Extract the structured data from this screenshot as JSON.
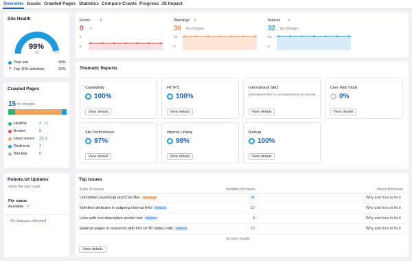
{
  "tabs": [
    "Overview",
    "Issues",
    "Crawled Pages",
    "Statistics",
    "Compare Crawls",
    "Progress",
    "JS Impact"
  ],
  "site_health": {
    "title": "Site Health",
    "score": "99%",
    "delta": "+3",
    "your_site_label": "Your site",
    "your_site_value": "99%",
    "top_label": "Top-10% websites",
    "top_value": "92%"
  },
  "crawled_pages": {
    "title": "Crawled Pages",
    "count": "15",
    "count_note": "no changes",
    "rows": [
      {
        "label": "Healthy",
        "value": "2",
        "delta": "+1",
        "color": "#2bb673"
      },
      {
        "label": "Broken",
        "value": "0",
        "delta": "",
        "color": "#e5484d"
      },
      {
        "label": "Have issues",
        "value": "12",
        "delta": "-1",
        "color": "#f0a35e"
      },
      {
        "label": "Redirects",
        "value": "1",
        "delta": "",
        "color": "#1e9bde"
      },
      {
        "label": "Blocked",
        "value": "0",
        "delta": "",
        "color": "#b0b4bd"
      }
    ]
  },
  "metrics": [
    {
      "label": "Errors",
      "value": "0",
      "delta": "-1",
      "color": "#e5484d",
      "fill": "#fbe0e2",
      "axis": [
        "1",
        "0"
      ]
    },
    {
      "label": "Warnings",
      "value": "36",
      "delta": "no changes",
      "color": "#f08a4b",
      "fill": "#fde6d6",
      "axis": [
        "36",
        "0"
      ]
    },
    {
      "label": "Notices",
      "value": "32",
      "delta": "no changes",
      "color": "#1e9bde",
      "fill": "#d6ecfa",
      "axis": [
        "32",
        "0"
      ]
    }
  ],
  "thematic": {
    "title": "Thematic Reports",
    "view_details": "View details",
    "cards": [
      {
        "name": "Crawlability",
        "value": "100%",
        "note": ""
      },
      {
        "name": "HTTPS",
        "value": "100%",
        "note": ""
      },
      {
        "name": "International SEO",
        "value": "",
        "note": "International SEO is not implemented on this site"
      },
      {
        "name": "Core Web Vitals",
        "value": "0%",
        "note": ""
      },
      {
        "name": "Site Performance",
        "value": "97%",
        "note": ""
      },
      {
        "name": "Internal Linking",
        "value": "99%",
        "note": ""
      },
      {
        "name": "Markup",
        "value": "100%",
        "note": ""
      }
    ]
  },
  "robots": {
    "title": "Robots.txt Updates",
    "since": "since the last crawl",
    "file_status_label": "File status",
    "file_status_value": "Available",
    "no_changes": "No changes detected"
  },
  "top_issues": {
    "title": "Top Issues",
    "col_type": "Type of issues",
    "col_num": "Number of issues",
    "col_about": "About the issue",
    "rows": [
      {
        "text": "Unminified JavaScript and CSS files",
        "badge": "warnings",
        "kind": "warn",
        "count": "36",
        "link": "Why and how to fix it"
      },
      {
        "text": "Nofollow attributes in outgoing internal links",
        "badge": "notices",
        "kind": "notice",
        "count": "12",
        "link": "Why and how to fix it"
      },
      {
        "text": "Links with non-descriptive anchor text",
        "badge": "notices",
        "kind": "notice",
        "count": "8",
        "link": "Why and how to fix it"
      },
      {
        "text": "External pages or resources with 403 HTTP status code",
        "badge": "notices",
        "kind": "notice",
        "count": "12",
        "link": "Why and how to fix it"
      }
    ],
    "no_more": "no more results",
    "view_details": "View details"
  },
  "colors": {
    "accent": "#1b5fd6",
    "ring": "#1e9bde"
  }
}
